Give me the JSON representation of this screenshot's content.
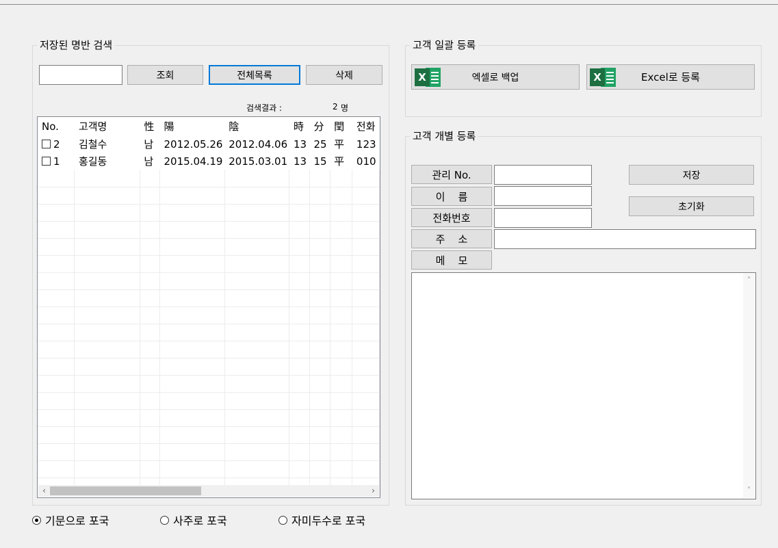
{
  "search_group": {
    "title": "저장된 명반 검색",
    "search_value": "",
    "buttons": {
      "query": "조회",
      "list_all": "전체목록",
      "delete": "삭제"
    },
    "result_label": "검색결과 :",
    "result_count": "2",
    "result_unit": "명",
    "columns": [
      "No.",
      "고객명",
      "性",
      "陽",
      "陰",
      "時",
      "分",
      "閏",
      "전화"
    ],
    "rows": [
      {
        "no": "2",
        "name": "김철수",
        "sex": "남",
        "solar": "2012.05.26",
        "lunar": "2012.04.06",
        "hour": "13",
        "minute": "25",
        "leap": "平",
        "phone": "123"
      },
      {
        "no": "1",
        "name": "홍길동",
        "sex": "남",
        "solar": "2015.04.19",
        "lunar": "2015.03.01",
        "hour": "13",
        "minute": "15",
        "leap": "平",
        "phone": "010"
      }
    ],
    "scroll_left": "‹",
    "scroll_right": "›"
  },
  "bulk_group": {
    "title": "고객 일괄 등록",
    "backup_label": "엑셀로 백업",
    "register_label": "Excel로 등록",
    "excel_glyph": "X"
  },
  "individual_group": {
    "title": "고객 개별 등록",
    "labels": {
      "id": "관리 No.",
      "name": "이    름",
      "phone": "전화번호",
      "address": "주    소",
      "memo": "메    모"
    },
    "values": {
      "id": "",
      "name": "",
      "phone": "",
      "address": "",
      "memo": ""
    },
    "save_label": "저장",
    "reset_label": "초기화",
    "scroll_up": "˄",
    "scroll_down": "˅"
  },
  "layout_options": {
    "options": [
      "기문으로 포국",
      "사주로 포국",
      "자미두수로 포국"
    ],
    "selected": "기문으로 포국"
  },
  "colors": {
    "excel_dark": "#1d6f42",
    "excel_light": "#21a366",
    "focus": "#0078d7"
  }
}
